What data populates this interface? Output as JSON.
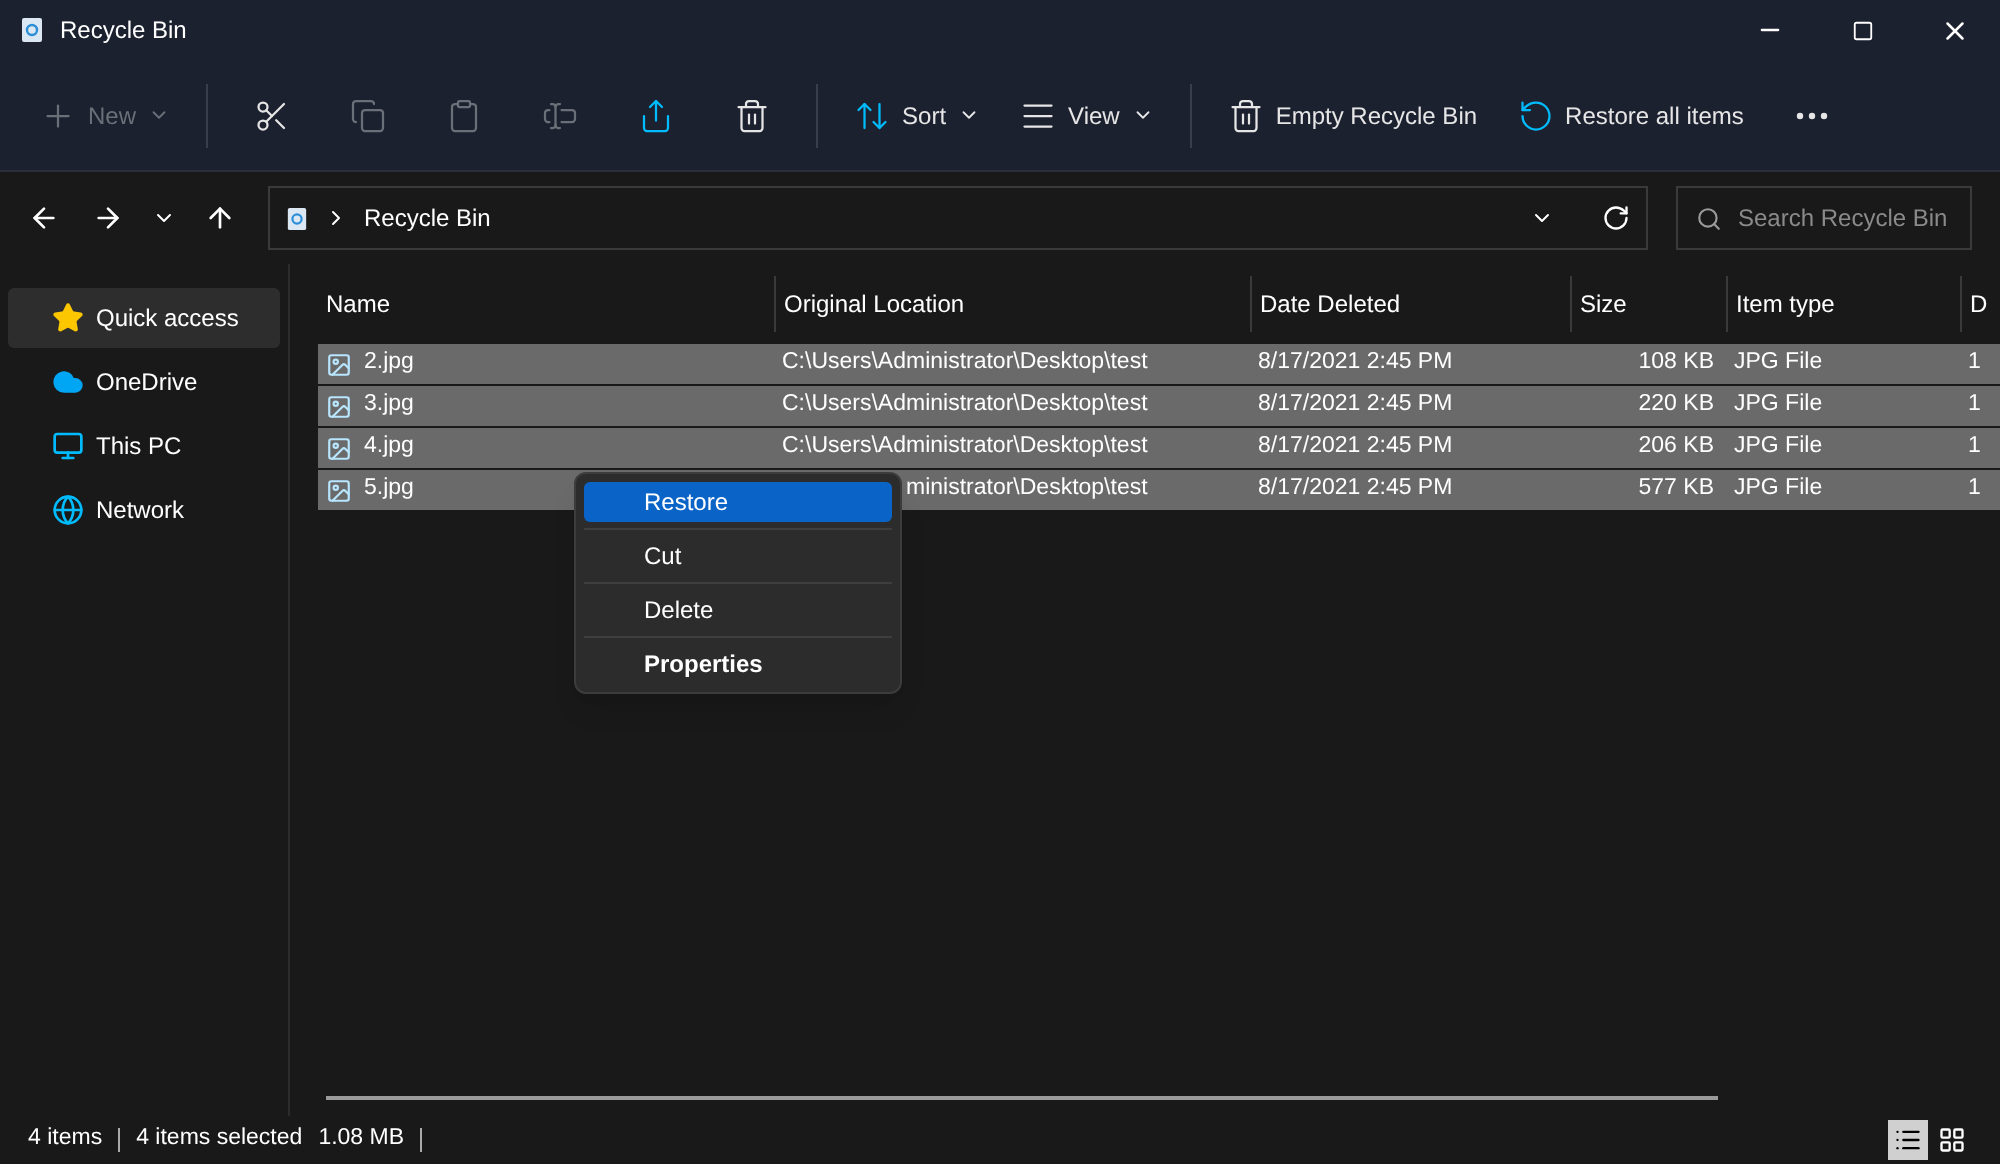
{
  "window": {
    "title": "Recycle Bin"
  },
  "toolbar": [
    {
      "kind": "labeled",
      "label": "New",
      "disabled": true,
      "dropdown": true
    },
    {
      "kind": "icon",
      "disabled": false
    },
    {
      "kind": "icon",
      "disabled": true
    },
    {
      "kind": "icon",
      "disabled": true
    },
    {
      "kind": "icon",
      "disabled": true
    },
    {
      "kind": "icon",
      "disabled": false
    },
    {
      "kind": "icon",
      "disabled": false
    },
    {
      "kind": "labeled",
      "label": "Sort",
      "disabled": false,
      "dropdown": true
    },
    {
      "kind": "labeled",
      "label": "View",
      "disabled": false,
      "dropdown": true
    },
    {
      "kind": "labeled",
      "label": "Empty Recycle Bin",
      "disabled": false,
      "dropdown": false
    },
    {
      "kind": "labeled",
      "label": "Restore all items",
      "disabled": false,
      "dropdown": false
    },
    {
      "kind": "icon",
      "disabled": false
    }
  ],
  "address": {
    "path": "Recycle Bin"
  },
  "search": {
    "placeholder": "Search Recycle Bin"
  },
  "sidebar": {
    "items": [
      {
        "label": "Quick access",
        "selected": true
      },
      {
        "label": "OneDrive",
        "selected": false
      },
      {
        "label": "This PC",
        "selected": false
      },
      {
        "label": "Network",
        "selected": false
      }
    ]
  },
  "table": {
    "columns": [
      "Name",
      "Original Location",
      "Date Deleted",
      "Size",
      "Item type",
      "D"
    ],
    "rows": [
      {
        "selected": true,
        "cells": [
          "2.jpg",
          "C:\\Users\\Administrator\\Desktop\\test",
          "8/17/2021 2:45 PM",
          "108 KB",
          "JPG File",
          "1"
        ]
      },
      {
        "selected": true,
        "cells": [
          "3.jpg",
          "C:\\Users\\Administrator\\Desktop\\test",
          "8/17/2021 2:45 PM",
          "220 KB",
          "JPG File",
          "1"
        ]
      },
      {
        "selected": true,
        "cells": [
          "4.jpg",
          "C:\\Users\\Administrator\\Desktop\\test",
          "8/17/2021 2:45 PM",
          "206 KB",
          "JPG File",
          "1"
        ]
      },
      {
        "selected": true,
        "partly_hidden": true,
        "cells": [
          "5.jpg",
          "ministrator\\Desktop\\test",
          "8/17/2021 2:45 PM",
          "577 KB",
          "JPG File",
          "1"
        ]
      }
    ]
  },
  "context_menu": {
    "items": [
      {
        "label": "Restore",
        "selected": true,
        "bold": false
      },
      {
        "label": "Cut",
        "selected": false,
        "bold": false
      },
      {
        "label": "Delete",
        "selected": false,
        "bold": false
      },
      {
        "label": "Properties",
        "selected": false,
        "bold": true
      }
    ]
  },
  "status_bar": {
    "count": "4 items",
    "selection": "4 items selected",
    "size": "1.08 MB"
  },
  "view_toggle": [
    {
      "selected": true
    },
    {
      "selected": false
    }
  ]
}
